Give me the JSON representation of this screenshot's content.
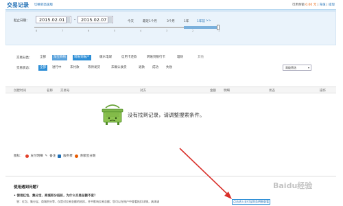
{
  "header": {
    "title": "交易记录",
    "switch_link": "切换到高级版",
    "balance_label": "可用余额",
    "balance_amount": "0.00 元",
    "recharge": "充值",
    "withdraw": "提现"
  },
  "filter": {
    "date_label": "起止日期：",
    "start_date": "2015.02.01",
    "end_date": "2015.02.07",
    "dash": "-",
    "quick_ranges": [
      "今天",
      "最近1个月",
      "3个月",
      "1年",
      "1年前"
    ],
    "slider_ticks": [
      "8",
      "7",
      "6",
      "5",
      "4",
      "3",
      "2",
      "1"
    ],
    "type_label": "交易分类：",
    "types": [
      "全部",
      "淘宝购物",
      "转账到账户",
      "缴水电煤",
      "信用卡还款",
      "转账到银行卡",
      "理财",
      "其他"
    ],
    "status_label": "交易状态：",
    "statuses": [
      "全部",
      "进行中",
      "未付款",
      "等待发货",
      "未确认收货",
      "退款",
      "成功",
      "失败"
    ],
    "advanced_button": "高级筛选"
  },
  "table": {
    "columns": [
      "创建时间",
      "名称",
      "交易号",
      "对方",
      "金额",
      "明细",
      "状态",
      "操作"
    ]
  },
  "empty": {
    "message": "没有找到记录，请调整搜索条件。"
  },
  "legend": {
    "label": "图标：",
    "items": [
      {
        "label": "支付明细",
        "color": "#e2402a"
      },
      {
        "label": "备注",
        "color": "#f0a000"
      },
      {
        "label": "服务费",
        "color": "#1f6fb5"
      },
      {
        "label": "余额宝分期",
        "color": "#e85b00"
      }
    ]
  },
  "help": {
    "title": "使用遇到问题？",
    "question": "使用红包、集分宝、商城积分抵扣，为什么交易总额不变？",
    "answer": "答：红包、集分宝、商城积分等，仅是对交易金额的抵扣，并不影响交易总额；您可以在账户中查看抵扣详情，具体请",
    "link": "点击进入支付宝财务明细查看"
  },
  "watermark": "Baidu经验"
}
